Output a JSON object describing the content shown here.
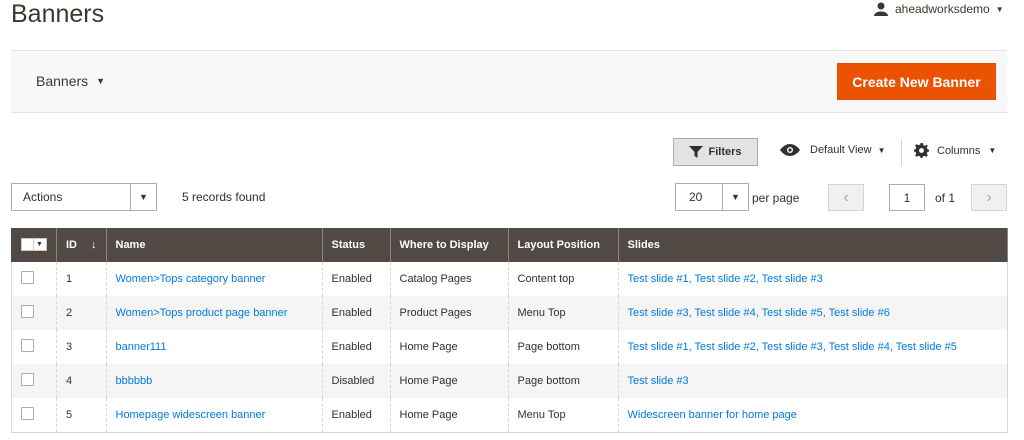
{
  "header": {
    "title": "Banners",
    "username": "aheadworksdemo"
  },
  "toolbar": {
    "switcher_label": "Banners",
    "create_button": "Create New Banner"
  },
  "grid_controls": {
    "filters_label": "Filters",
    "view_label": "Default View",
    "columns_label": "Columns",
    "actions_label": "Actions",
    "records_text": "5 records found",
    "per_page_value": "20",
    "per_page_label": "per page",
    "current_page": "1",
    "of_pages": "of 1"
  },
  "table": {
    "headers": [
      "ID",
      "Name",
      "Status",
      "Where to Display",
      "Layout Position",
      "Slides"
    ],
    "rows": [
      {
        "id": "1",
        "name": "Women>Tops category banner",
        "status": "Enabled",
        "where": "Catalog Pages",
        "position": "Content top",
        "slides": "Test slide #1, Test slide #2, Test slide #3"
      },
      {
        "id": "2",
        "name": "Women>Tops product page banner",
        "status": "Enabled",
        "where": "Product Pages",
        "position": "Menu Top",
        "slides": "Test slide #3, Test slide #4, Test slide #5, Test slide #6"
      },
      {
        "id": "3",
        "name": "banner111",
        "status": "Enabled",
        "where": "Home Page",
        "position": "Page bottom",
        "slides": "Test slide #1, Test slide #2, Test slide #3, Test slide #4, Test slide #5"
      },
      {
        "id": "4",
        "name": "bbbbbb",
        "status": "Disabled",
        "where": "Home Page",
        "position": "Page bottom",
        "slides": "Test slide #3"
      },
      {
        "id": "5",
        "name": "Homepage widescreen banner",
        "status": "Enabled",
        "where": "Home Page",
        "position": "Menu Top",
        "slides": "Widescreen banner for home page"
      }
    ]
  },
  "colors": {
    "accent": "#eb5202",
    "header_bg": "#514943",
    "link": "#007bdb"
  }
}
